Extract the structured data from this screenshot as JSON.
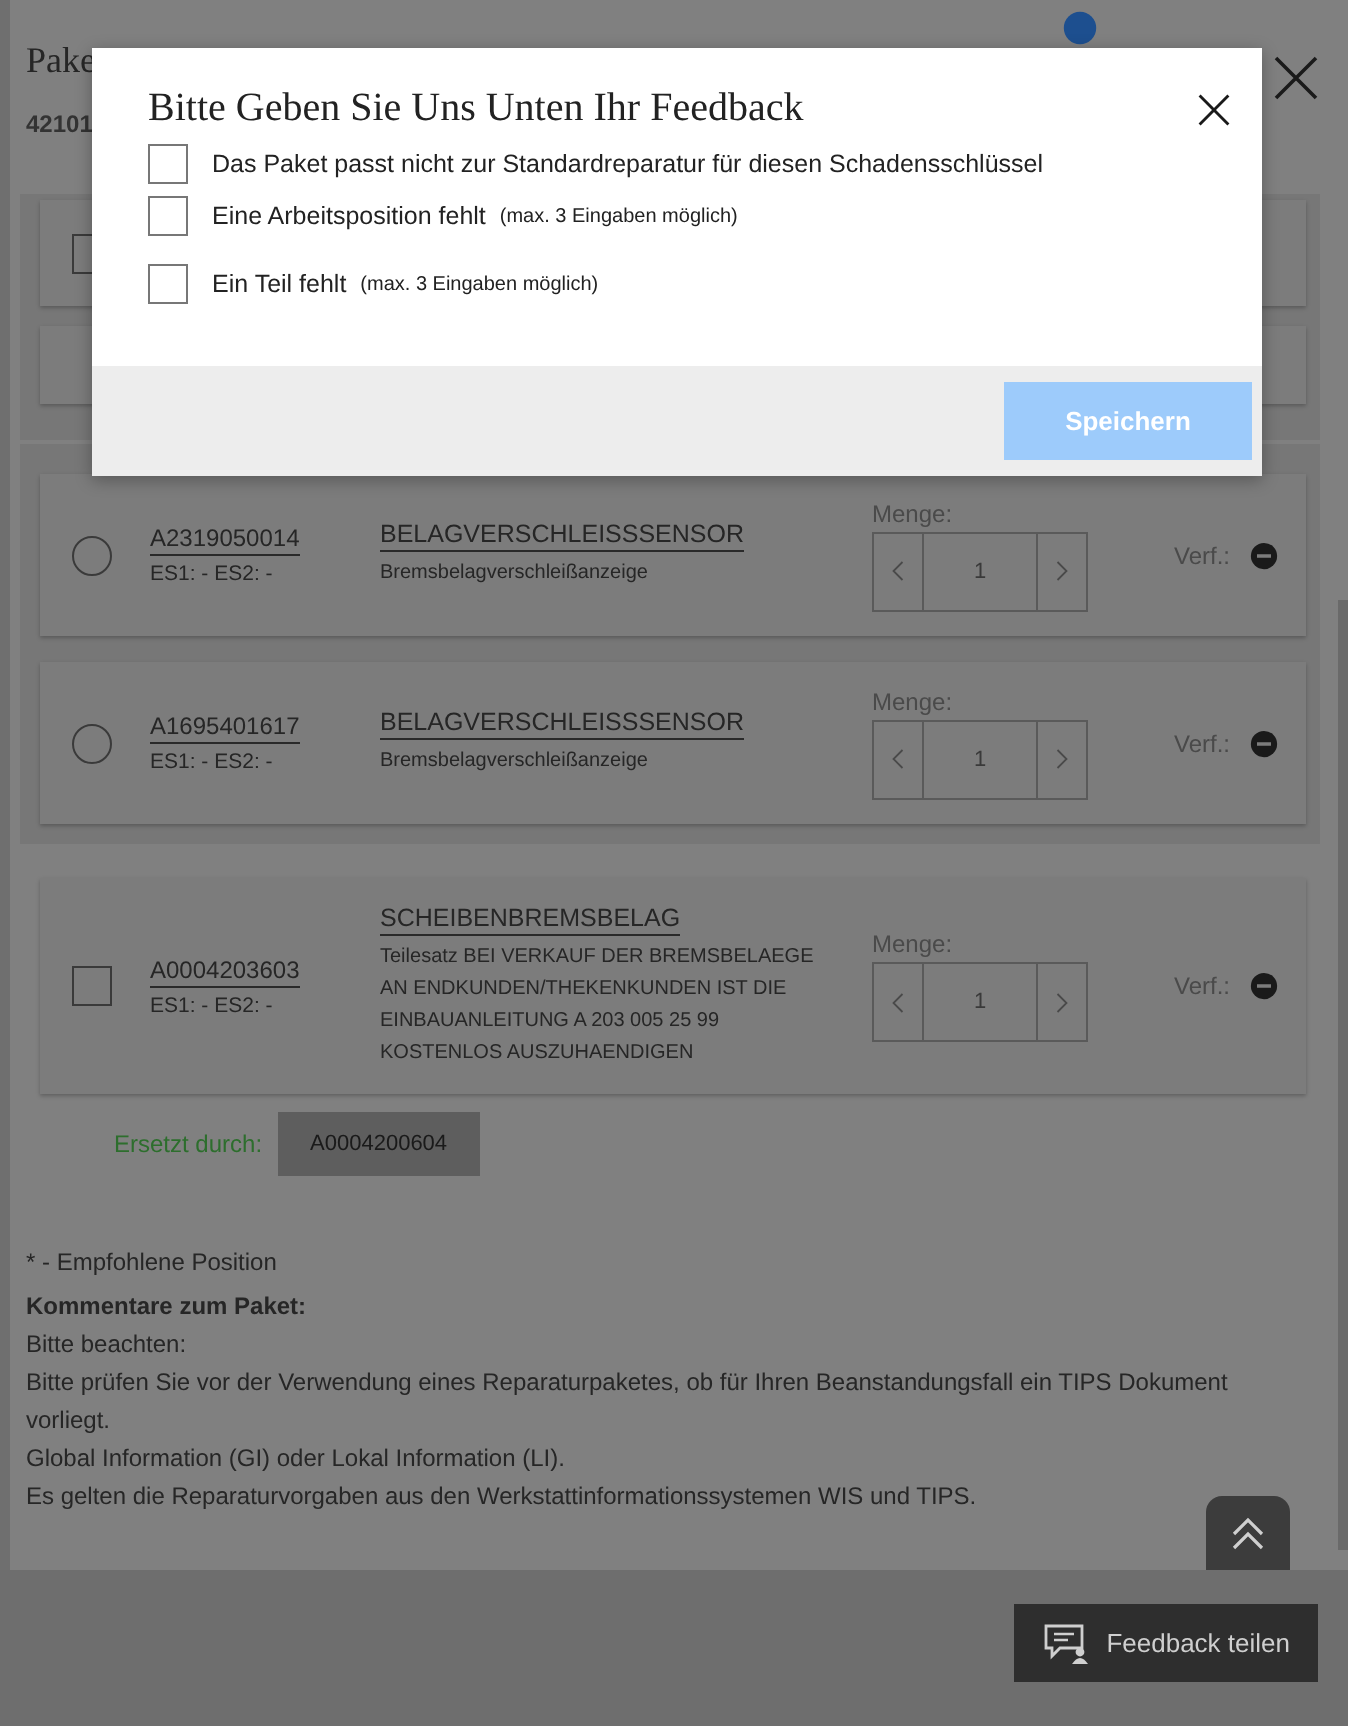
{
  "page": {
    "title": "Pake",
    "subtitle": "42101"
  },
  "groups": [
    {
      "panel": true,
      "items": [
        {
          "kind": "checkbox"
        },
        {
          "kind": "blank"
        }
      ]
    },
    {
      "panel": true,
      "items": [
        {
          "kind": "radio",
          "selected": false,
          "part_number": "A2319050014",
          "es": "ES1: -  ES2: -",
          "name": "BELAGVERSCHLEISSSENSOR",
          "description": "Bremsbelagverschleißanzeige",
          "quantity_label": "Menge:",
          "quantity": "1",
          "status_label": "Verf.:"
        },
        {
          "kind": "radio",
          "selected": false,
          "part_number": "A1695401617",
          "es": "ES1: -  ES2: -",
          "name": "BELAGVERSCHLEISSSENSOR",
          "description": "Bremsbelagverschleißanzeige",
          "quantity_label": "Menge:",
          "quantity": "1",
          "status_label": "Verf.:"
        }
      ]
    },
    {
      "panel": false,
      "items": [
        {
          "kind": "checkbox",
          "checked": false,
          "part_number": "A0004203603",
          "es": "ES1: -  ES2: -",
          "name": "SCHEIBENBREMSBELAG",
          "description": "Teilesatz BEI VERKAUF DER BREMSBELAEGE AN ENDKUNDEN/THEKENKUNDEN IST DIE EINBAUANLEITUNG A 203 005 25 99 KOSTENLOS AUSZUHAENDIGEN",
          "quantity_label": "Menge:",
          "quantity": "1",
          "status_label": "Verf.:"
        }
      ]
    }
  ],
  "replacement": {
    "label": "Ersetzt durch:",
    "part_number": "A0004200604"
  },
  "notes": [
    {
      "kind": "text",
      "text": "* - Empfohlene Position"
    },
    {
      "kind": "heading",
      "text": "Kommentare zum Paket:"
    },
    {
      "kind": "line",
      "text": "Bitte beachten:"
    },
    {
      "kind": "line",
      "text": "Bitte prüfen Sie vor der Verwendung eines Reparaturpaketes, ob für Ihren Beanstandungsfall ein TIPS Dokument vorliegt."
    },
    {
      "kind": "line",
      "text": "Global Information (GI) oder Lokal Information (LI)."
    },
    {
      "kind": "line",
      "text": "Es gelten die Reparaturvorgaben aus den Werkstattinformationssystemen WIS und TIPS."
    }
  ],
  "feedback_button": "Feedback teilen",
  "dialog": {
    "title": "Bitte Geben Sie Uns Unten Ihr Feedback",
    "options": [
      {
        "label": "Das Paket passt nicht zur Standardreparatur für diesen Schadensschlüssel",
        "checked": false
      },
      {
        "label": "Eine Arbeitsposition fehlt",
        "hint": "(max. 3 Eingaben möglich)",
        "checked": false
      },
      {
        "label": "Ein Teil fehlt",
        "hint": "(max. 3 Eingaben möglich)",
        "checked": false
      }
    ],
    "save_button": "Speichern",
    "save_disabled": true
  }
}
